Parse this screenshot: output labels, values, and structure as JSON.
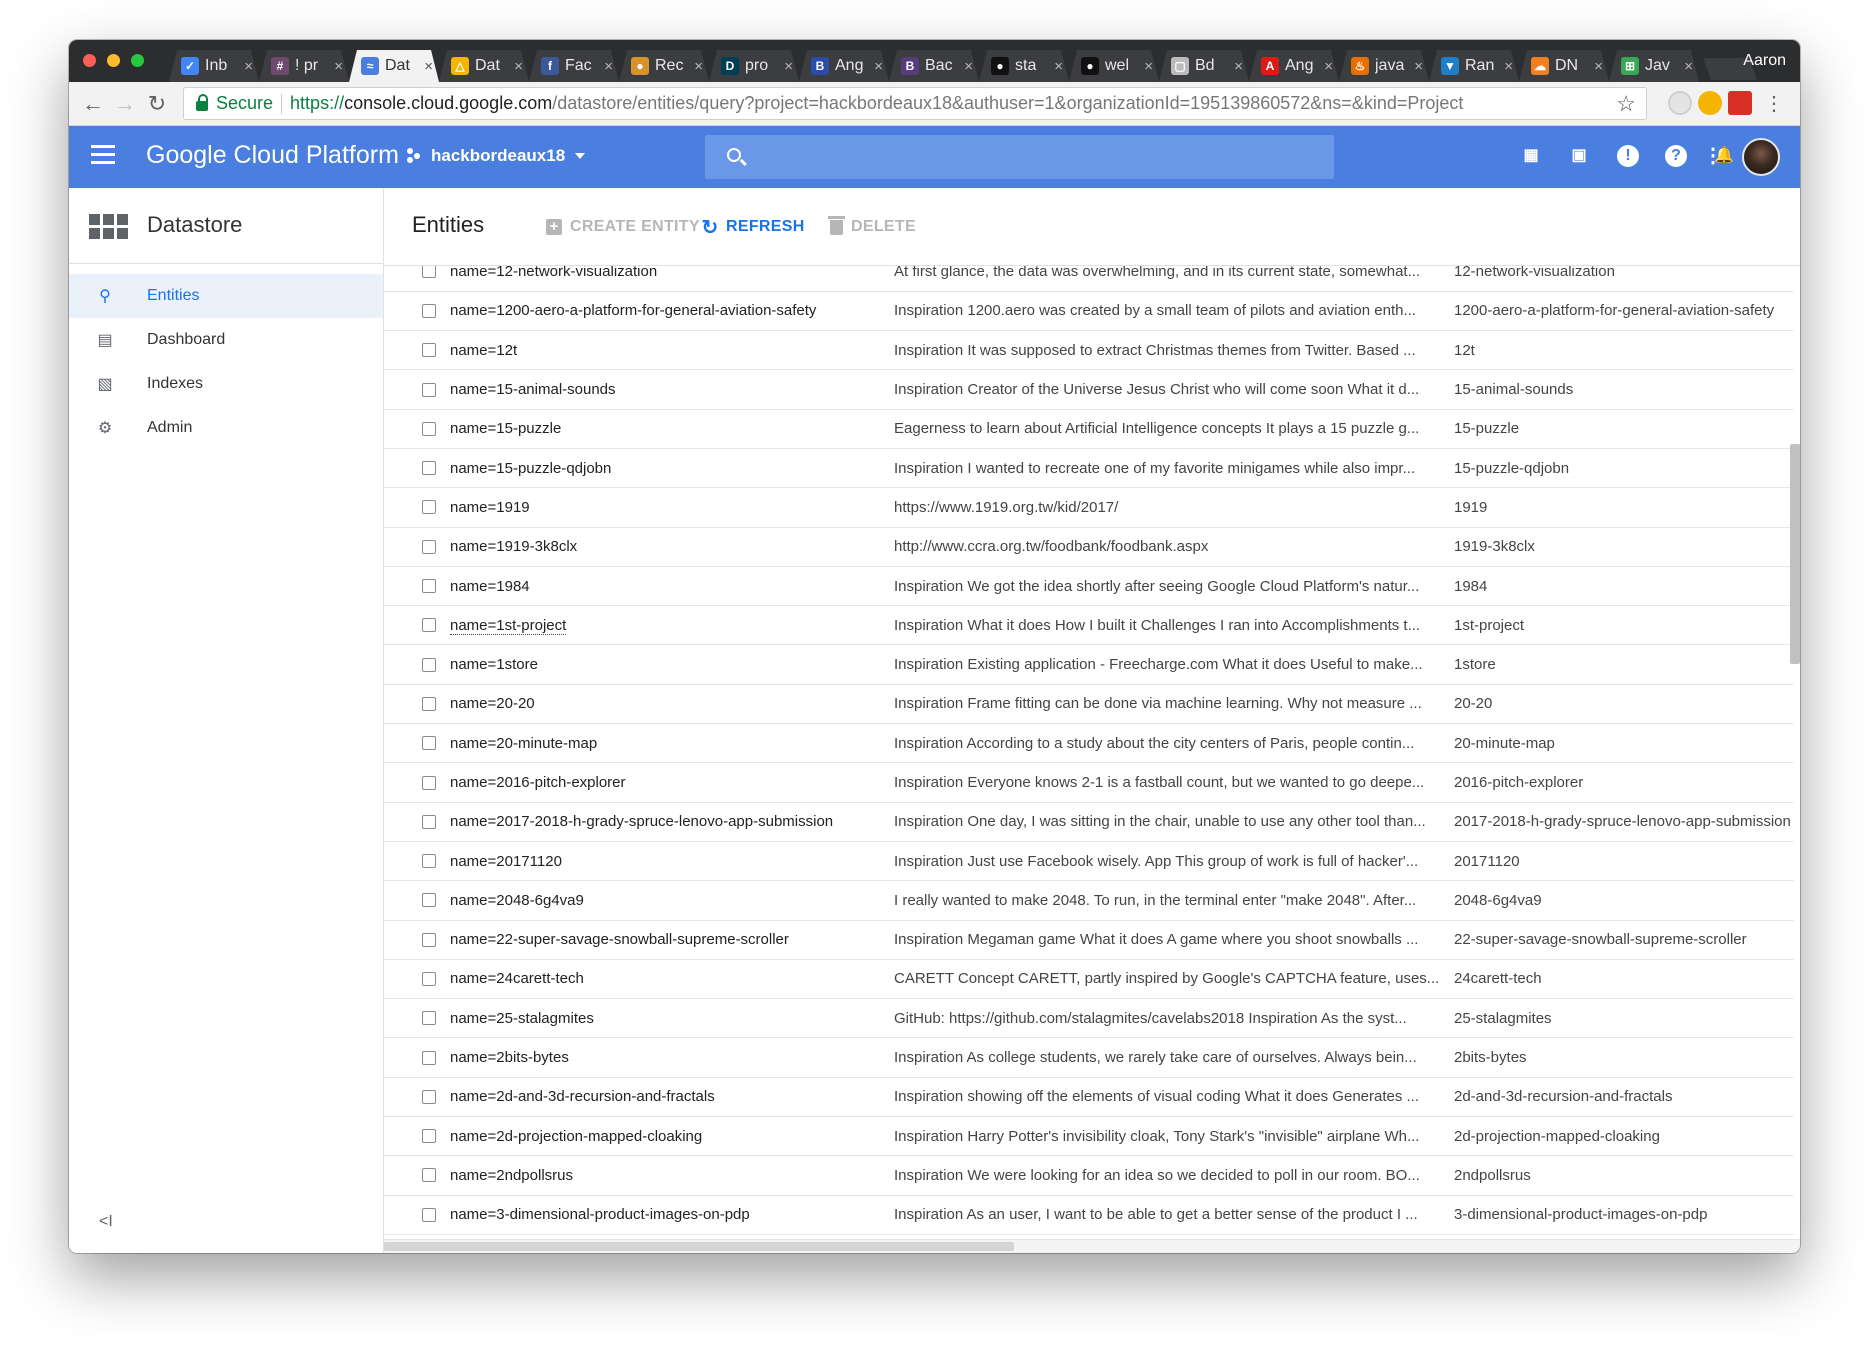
{
  "browser": {
    "profile_name": "Aaron",
    "tabs": [
      {
        "title": "Inb",
        "icon": "inbox-icon",
        "color": "#4285f4",
        "glyph": "✓"
      },
      {
        "title": "! pr",
        "icon": "slack-icon",
        "color": "#6e4a6f",
        "glyph": "#"
      },
      {
        "title": "Dat",
        "icon": "datastudio-icon",
        "color": "#4a7fe0",
        "glyph": "≈",
        "active": true
      },
      {
        "title": "Dat",
        "icon": "google-drive-icon",
        "color": "#f4b400",
        "glyph": "△"
      },
      {
        "title": "Fac",
        "icon": "facebook-icon",
        "color": "#3b5998",
        "glyph": "f"
      },
      {
        "title": "Rec",
        "icon": "burger-icon",
        "color": "#d8932a",
        "glyph": "●"
      },
      {
        "title": "pro",
        "icon": "devpost-icon",
        "color": "#003e54",
        "glyph": "D"
      },
      {
        "title": "Ang",
        "icon": "bootstrap-icon",
        "color": "#2b4ca8",
        "glyph": "B"
      },
      {
        "title": "Bac",
        "icon": "bootstrap-icon",
        "color": "#563d7c",
        "glyph": "B"
      },
      {
        "title": "sta",
        "icon": "github-icon",
        "color": "#111111",
        "glyph": "●"
      },
      {
        "title": "wel",
        "icon": "github-icon",
        "color": "#111111",
        "glyph": "●"
      },
      {
        "title": "Bd",
        "icon": "document-icon",
        "color": "#bbbbbb",
        "glyph": "▢"
      },
      {
        "title": "Ang",
        "icon": "angular-icon",
        "color": "#dd1b16",
        "glyph": "A"
      },
      {
        "title": "java",
        "icon": "java-icon",
        "color": "#e76f00",
        "glyph": "♨"
      },
      {
        "title": "Ran",
        "icon": "flag-icon",
        "color": "#1e7ec8",
        "glyph": "▼"
      },
      {
        "title": "DN",
        "icon": "cloudflare-icon",
        "color": "#f38020",
        "glyph": "☁"
      },
      {
        "title": "Jav",
        "icon": "spreadsheet-icon",
        "color": "#3aa757",
        "glyph": "⊞"
      }
    ],
    "address": {
      "secure_label": "Secure",
      "scheme": "https://",
      "host": "console.cloud.google.com",
      "path": "/datastore/entities/query?project=hackbordeaux18&authuser=1&organizationId=195139860572&ns=&kind=Project"
    }
  },
  "header": {
    "product_name": "Google Cloud Platform",
    "project": "hackbordeaux18",
    "search_placeholder": ""
  },
  "sidebar": {
    "title": "Datastore",
    "items": [
      {
        "label": "Entities",
        "icon": "search-icon",
        "active": true
      },
      {
        "label": "Dashboard",
        "icon": "dashboard-icon"
      },
      {
        "label": "Indexes",
        "icon": "indexes-icon"
      },
      {
        "label": "Admin",
        "icon": "gear-icon"
      }
    ],
    "collapse_label": "<I"
  },
  "main": {
    "title": "Entities",
    "actions": {
      "create": "CREATE ENTITY",
      "refresh": "REFRESH",
      "delete": "DELETE"
    },
    "rows": [
      {
        "key": "name=12-network-visualization",
        "description": "At first glance, the data was overwhelming, and in its current state, somewhat...",
        "name": "12-network-visualization"
      },
      {
        "key": "name=1200-aero-a-platform-for-general-aviation-safety",
        "description": "Inspiration 1200.aero was created by a small team of pilots and aviation enth...",
        "name": "1200-aero-a-platform-for-general-aviation-safety"
      },
      {
        "key": "name=12t",
        "description": "Inspiration It was supposed to extract Christmas themes from Twitter. Based ...",
        "name": "12t"
      },
      {
        "key": "name=15-animal-sounds",
        "description": "Inspiration Creator of the Universe Jesus Christ who will come soon What it d...",
        "name": "15-animal-sounds"
      },
      {
        "key": "name=15-puzzle",
        "description": "Eagerness to learn about Artificial Intelligence concepts It plays a 15 puzzle g...",
        "name": "15-puzzle"
      },
      {
        "key": "name=15-puzzle-qdjobn",
        "description": "Inspiration I wanted to recreate one of my favorite minigames while also impr...",
        "name": "15-puzzle-qdjobn"
      },
      {
        "key": "name=1919",
        "description": "https://www.1919.org.tw/kid/2017/",
        "name": "1919"
      },
      {
        "key": "name=1919-3k8clx",
        "description": "http://www.ccra.org.tw/foodbank/foodbank.aspx",
        "name": "1919-3k8clx"
      },
      {
        "key": "name=1984",
        "description": "Inspiration We got the idea shortly after seeing Google Cloud Platform's natur...",
        "name": "1984"
      },
      {
        "key": "name=1st-project",
        "description": "Inspiration What it does How I built it Challenges I ran into Accomplishments t...",
        "name": "1st-project",
        "hover": true
      },
      {
        "key": "name=1store",
        "description": "Inspiration Existing application - Freecharge.com What it does Useful to make...",
        "name": "1store"
      },
      {
        "key": "name=20-20",
        "description": "Inspiration Frame fitting can be done via machine learning. Why not measure ...",
        "name": "20-20"
      },
      {
        "key": "name=20-minute-map",
        "description": "Inspiration According to a study about the city centers of Paris, people contin...",
        "name": "20-minute-map"
      },
      {
        "key": "name=2016-pitch-explorer",
        "description": "Inspiration Everyone knows 2-1 is a fastball count, but we wanted to go deepe...",
        "name": "2016-pitch-explorer"
      },
      {
        "key": "name=2017-2018-h-grady-spruce-lenovo-app-submission",
        "description": "Inspiration One day, I was sitting in the chair, unable to use any other tool than...",
        "name": "2017-2018-h-grady-spruce-lenovo-app-submission"
      },
      {
        "key": "name=20171120",
        "description": "Inspiration Just use Facebook wisely. App This group of work is full of hacker'...",
        "name": "20171120"
      },
      {
        "key": "name=2048-6g4va9",
        "description": "I really wanted to make 2048. To run, in the terminal enter \"make 2048\". After...",
        "name": "2048-6g4va9"
      },
      {
        "key": "name=22-super-savage-snowball-supreme-scroller",
        "description": "Inspiration Megaman game What it does A game where you shoot snowballs ...",
        "name": "22-super-savage-snowball-supreme-scroller"
      },
      {
        "key": "name=24carett-tech",
        "description": "CARETT Concept CARETT, partly inspired by Google's CAPTCHA feature, uses...",
        "name": "24carett-tech"
      },
      {
        "key": "name=25-stalagmites",
        "description": "GitHub: https://github.com/stalagmites/cavelabs2018 Inspiration As the syst...",
        "name": "25-stalagmites"
      },
      {
        "key": "name=2bits-bytes",
        "description": "Inspiration As college students, we rarely take care of ourselves. Always bein...",
        "name": "2bits-bytes"
      },
      {
        "key": "name=2d-and-3d-recursion-and-fractals",
        "description": "Inspiration showing off the elements of visual coding What it does Generates ...",
        "name": "2d-and-3d-recursion-and-fractals"
      },
      {
        "key": "name=2d-projection-mapped-cloaking",
        "description": "Inspiration Harry Potter's invisibility cloak, Tony Stark's \"invisible\" airplane Wh...",
        "name": "2d-projection-mapped-cloaking"
      },
      {
        "key": "name=2ndpollsrus",
        "description": "Inspiration We were looking for an idea so we decided to poll in our room. BO...",
        "name": "2ndpollsrus"
      },
      {
        "key": "name=3-dimensional-product-images-on-pdp",
        "description": "Inspiration As an user, I want to be able to get a better sense of the product I ...",
        "name": "3-dimensional-product-images-on-pdp"
      }
    ]
  },
  "colors": {
    "header_blue": "#4a7fe0",
    "accent_blue": "#1a73e8",
    "secure_green": "#0b8043"
  }
}
